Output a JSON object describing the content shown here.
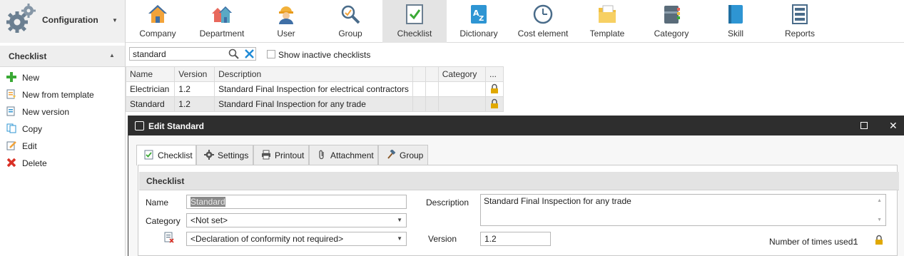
{
  "ribbon": {
    "config_label": "Configuration",
    "items": [
      {
        "label": "Company",
        "icon": "house-icon"
      },
      {
        "label": "Department",
        "icon": "department-house-icon"
      },
      {
        "label": "User",
        "icon": "worker-icon"
      },
      {
        "label": "Group",
        "icon": "group-magnifier-icon"
      },
      {
        "label": "Checklist",
        "icon": "checklist-icon"
      },
      {
        "label": "Dictionary",
        "icon": "dictionary-icon"
      },
      {
        "label": "Cost element",
        "icon": "clock-icon"
      },
      {
        "label": "Template",
        "icon": "template-folder-icon"
      },
      {
        "label": "Category",
        "icon": "category-binder-icon"
      },
      {
        "label": "Skill",
        "icon": "skill-book-icon"
      },
      {
        "label": "Reports",
        "icon": "reports-icon"
      }
    ],
    "active": "Checklist"
  },
  "left_panel": {
    "title": "Checklist",
    "actions": [
      {
        "label": "New",
        "icon": "plus-icon"
      },
      {
        "label": "New from template",
        "icon": "template-icon"
      },
      {
        "label": "New version",
        "icon": "new-version-icon"
      },
      {
        "label": "Copy",
        "icon": "copy-icon"
      },
      {
        "label": "Edit",
        "icon": "edit-icon"
      },
      {
        "label": "Delete",
        "icon": "delete-x-icon"
      }
    ]
  },
  "search": {
    "value": "standard",
    "show_inactive_label": "Show inactive checklists"
  },
  "grid": {
    "columns": [
      "Name",
      "Version",
      "Description",
      "",
      "",
      "Category",
      "..."
    ],
    "rows": [
      {
        "name": "Electrician",
        "version": "1.2",
        "description": "Standard Final Inspection for electrical contractors",
        "category": "",
        "locked": true
      },
      {
        "name": "Standard",
        "version": "1.2",
        "description": "Standard Final Inspection for any trade",
        "category": "",
        "locked": true
      }
    ]
  },
  "edit_window": {
    "title": "Edit Standard",
    "tabs": [
      {
        "label": "Checklist",
        "icon": "checklist-tab-icon"
      },
      {
        "label": "Settings",
        "icon": "gear-tab-icon"
      },
      {
        "label": "Printout",
        "icon": "printer-icon"
      },
      {
        "label": "Attachment",
        "icon": "paperclip-icon"
      },
      {
        "label": "Group",
        "icon": "hammer-icon"
      }
    ],
    "section_title": "Checklist",
    "form": {
      "name_label": "Name",
      "name_value": "Standard",
      "category_label": "Category",
      "category_value": "<Not set>",
      "conformity_value": "<Declaration of conformity not required>",
      "description_label": "Description",
      "description_value": "Standard Final Inspection for any trade",
      "version_label": "Version",
      "version_value": "1.2",
      "times_used_label": "Number of times used:",
      "times_used_value": "1"
    }
  },
  "colors": {
    "title_bar": "#2e2e2e",
    "active_ribbon": "#e4e4e4",
    "lock": "#e0a800",
    "plus": "#3aa935",
    "delete": "#d93025"
  }
}
